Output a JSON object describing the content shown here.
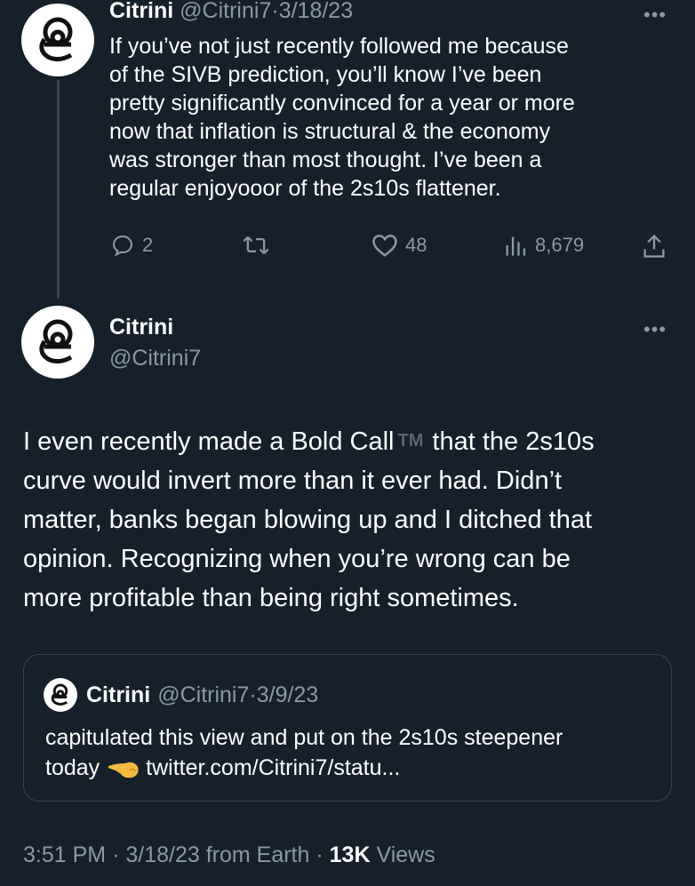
{
  "tweet1": {
    "name": "Citrini",
    "handle": "@Citrini7",
    "sep": "·",
    "date": "3/18/23",
    "more": "•••",
    "text": "If you’ve not just recently followed me because\nof the SIVB prediction, you’ll know I’ve been\npretty significantly convinced for a year or more\nnow that inflation is structural & the economy\nwas stronger than most thought. I’ve been a\nregular enjoyooor of the 2s10s flattener.",
    "replies": "2",
    "likes": "48",
    "views": "8,679"
  },
  "tweet2": {
    "name": "Citrini",
    "handle": "@Citrini7",
    "more": "•••",
    "text_before_tm": "I even recently made a Bold Call",
    "tm": "TM",
    "text_after_tm": "that the 2s10s\ncurve would invert more than it ever had. Didn’t\nmatter, banks began blowing up and I ditched that\nopinion. Recognizing when you’re wrong can be\nmore profitable than being right sometimes.",
    "quote": {
      "name": "Citrini",
      "handle": "@Citrini7",
      "sep": "·",
      "date": "3/9/23",
      "text_line1": "capitulated this view and put on the 2s10s steepener",
      "text_today": "today",
      "link": "twitter.com/Citrini7/statu..."
    },
    "footer": {
      "time": "3:51 PM",
      "sep1": "·",
      "date": "3/18/23 from Earth",
      "sep2": "·",
      "views_count": "13K",
      "views_label": "Views"
    }
  },
  "colors": {
    "background": "#15202b",
    "muted": "#8b98a5",
    "border": "#38444d"
  }
}
